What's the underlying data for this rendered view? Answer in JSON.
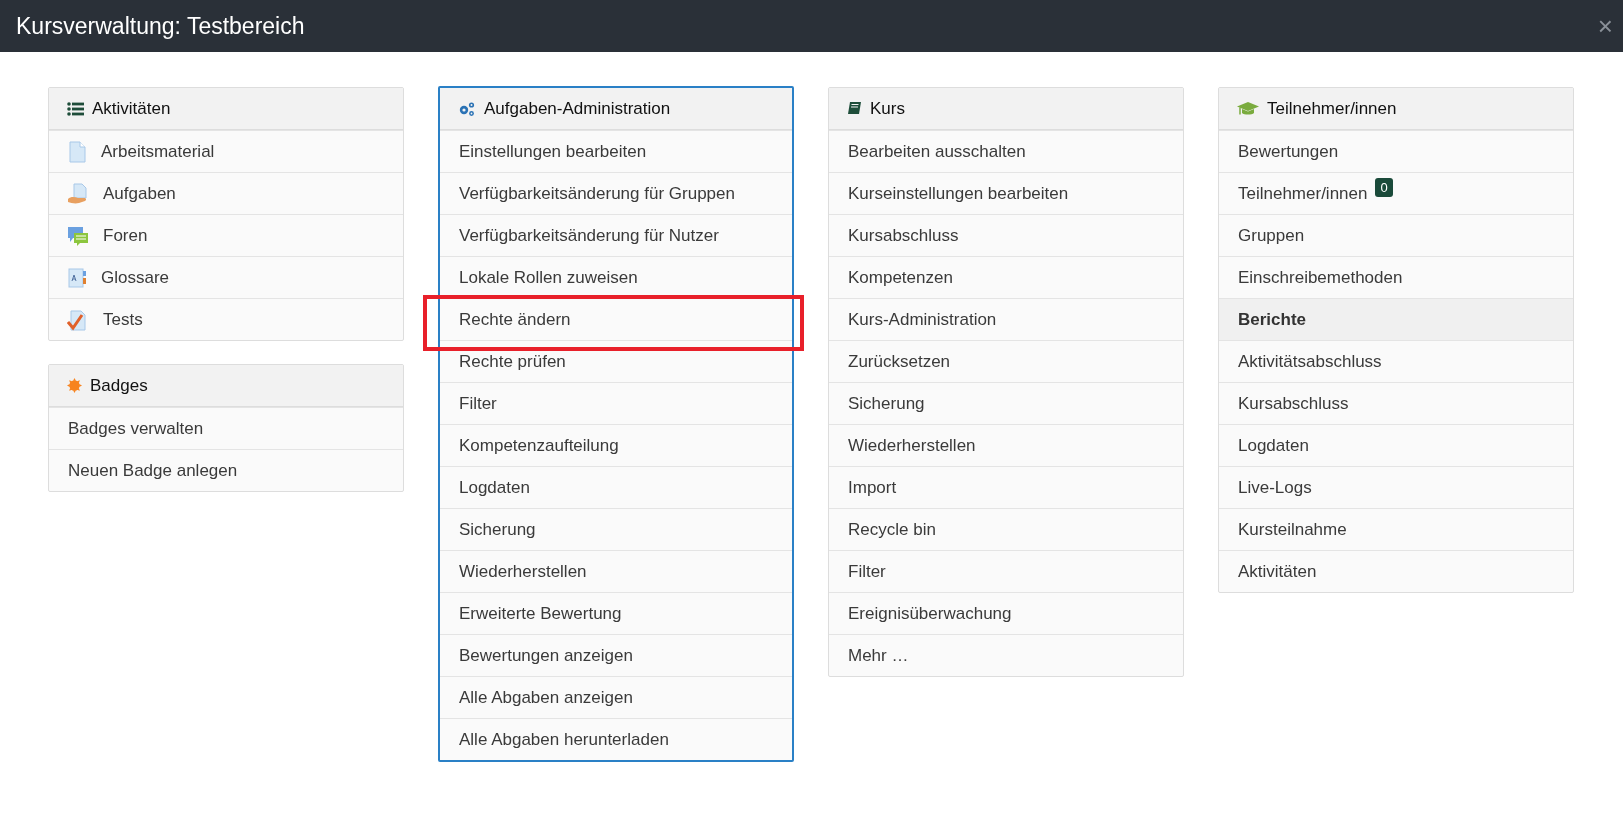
{
  "window": {
    "title": "Kursverwaltung: Testbereich",
    "close": "×"
  },
  "columns": [
    {
      "panels": [
        {
          "title": "Aktivitäten",
          "kind": "activities",
          "active": false,
          "items": [
            {
              "label": "Arbeitsmaterial",
              "kind": "link",
              "highlighted": false
            },
            {
              "label": "Aufgaben",
              "kind": "link",
              "highlighted": false
            },
            {
              "label": "Foren",
              "kind": "link",
              "highlighted": false
            },
            {
              "label": "Glossare",
              "kind": "link",
              "highlighted": false
            },
            {
              "label": "Tests",
              "kind": "link",
              "highlighted": false
            }
          ]
        },
        {
          "title": "Badges",
          "kind": "badges",
          "active": false,
          "items": [
            {
              "label": "Badges verwalten",
              "kind": "link",
              "highlighted": false
            },
            {
              "label": "Neuen Badge anlegen",
              "kind": "link",
              "highlighted": false
            }
          ]
        }
      ]
    },
    {
      "panels": [
        {
          "title": "Aufgaben-Administration",
          "kind": "admin",
          "active": true,
          "items": [
            {
              "label": "Einstellungen bearbeiten",
              "kind": "link",
              "highlighted": false
            },
            {
              "label": "Verfügbarkeitsänderung für Gruppen",
              "kind": "link",
              "highlighted": false
            },
            {
              "label": "Verfügbarkeitsänderung für Nutzer",
              "kind": "link",
              "highlighted": false
            },
            {
              "label": "Lokale Rollen zuweisen",
              "kind": "link",
              "highlighted": false
            },
            {
              "label": "Rechte ändern",
              "kind": "link",
              "highlighted": true
            },
            {
              "label": "Rechte prüfen",
              "kind": "link",
              "highlighted": false
            },
            {
              "label": "Filter",
              "kind": "link",
              "highlighted": false
            },
            {
              "label": "Kompetenzaufteilung",
              "kind": "link",
              "highlighted": false
            },
            {
              "label": "Logdaten",
              "kind": "link",
              "highlighted": false
            },
            {
              "label": "Sicherung",
              "kind": "link",
              "highlighted": false
            },
            {
              "label": "Wiederherstellen",
              "kind": "link",
              "highlighted": false
            },
            {
              "label": "Erweiterte Bewertung",
              "kind": "link",
              "highlighted": false
            },
            {
              "label": "Bewertungen anzeigen",
              "kind": "link",
              "highlighted": false
            },
            {
              "label": "Alle Abgaben anzeigen",
              "kind": "link",
              "highlighted": false
            },
            {
              "label": "Alle Abgaben herunterladen",
              "kind": "link",
              "highlighted": false
            }
          ]
        }
      ]
    },
    {
      "panels": [
        {
          "title": "Kurs",
          "kind": "course",
          "active": false,
          "items": [
            {
              "label": "Bearbeiten ausschalten",
              "kind": "link",
              "highlighted": false
            },
            {
              "label": "Kurseinstellungen bearbeiten",
              "kind": "link",
              "highlighted": false
            },
            {
              "label": "Kursabschluss",
              "kind": "link",
              "highlighted": false
            },
            {
              "label": "Kompetenzen",
              "kind": "link",
              "highlighted": false
            },
            {
              "label": "Kurs-Administration",
              "kind": "link",
              "highlighted": false
            },
            {
              "label": "Zurücksetzen",
              "kind": "link",
              "highlighted": false
            },
            {
              "label": "Sicherung",
              "kind": "link",
              "highlighted": false
            },
            {
              "label": "Wiederherstellen",
              "kind": "link",
              "highlighted": false
            },
            {
              "label": "Import",
              "kind": "link",
              "highlighted": false
            },
            {
              "label": "Recycle bin",
              "kind": "link",
              "highlighted": false
            },
            {
              "label": "Filter",
              "kind": "link",
              "highlighted": false
            },
            {
              "label": "Ereignisüberwachung",
              "kind": "link",
              "highlighted": false
            },
            {
              "label": "Mehr …",
              "kind": "link",
              "highlighted": false
            }
          ]
        }
      ]
    },
    {
      "panels": [
        {
          "title": "Teilnehmer/innen",
          "kind": "participants",
          "active": false,
          "items": [
            {
              "label": "Bewertungen",
              "kind": "link",
              "highlighted": false
            },
            {
              "label": "Teilnehmer/innen",
              "kind": "link",
              "count": "0",
              "highlighted": false
            },
            {
              "label": "Gruppen",
              "kind": "link",
              "highlighted": false
            },
            {
              "label": "Einschreibemethoden",
              "kind": "link",
              "highlighted": false
            },
            {
              "label": "Berichte",
              "kind": "heading",
              "highlighted": false
            },
            {
              "label": "Aktivitätsabschluss",
              "kind": "link",
              "highlighted": false
            },
            {
              "label": "Kursabschluss",
              "kind": "link",
              "highlighted": false
            },
            {
              "label": "Logdaten",
              "kind": "link",
              "highlighted": false
            },
            {
              "label": "Live-Logs",
              "kind": "link",
              "highlighted": false
            },
            {
              "label": "Kursteilnahme",
              "kind": "link",
              "highlighted": false
            },
            {
              "label": "Aktivitäten",
              "kind": "link",
              "highlighted": false
            }
          ]
        }
      ]
    }
  ]
}
